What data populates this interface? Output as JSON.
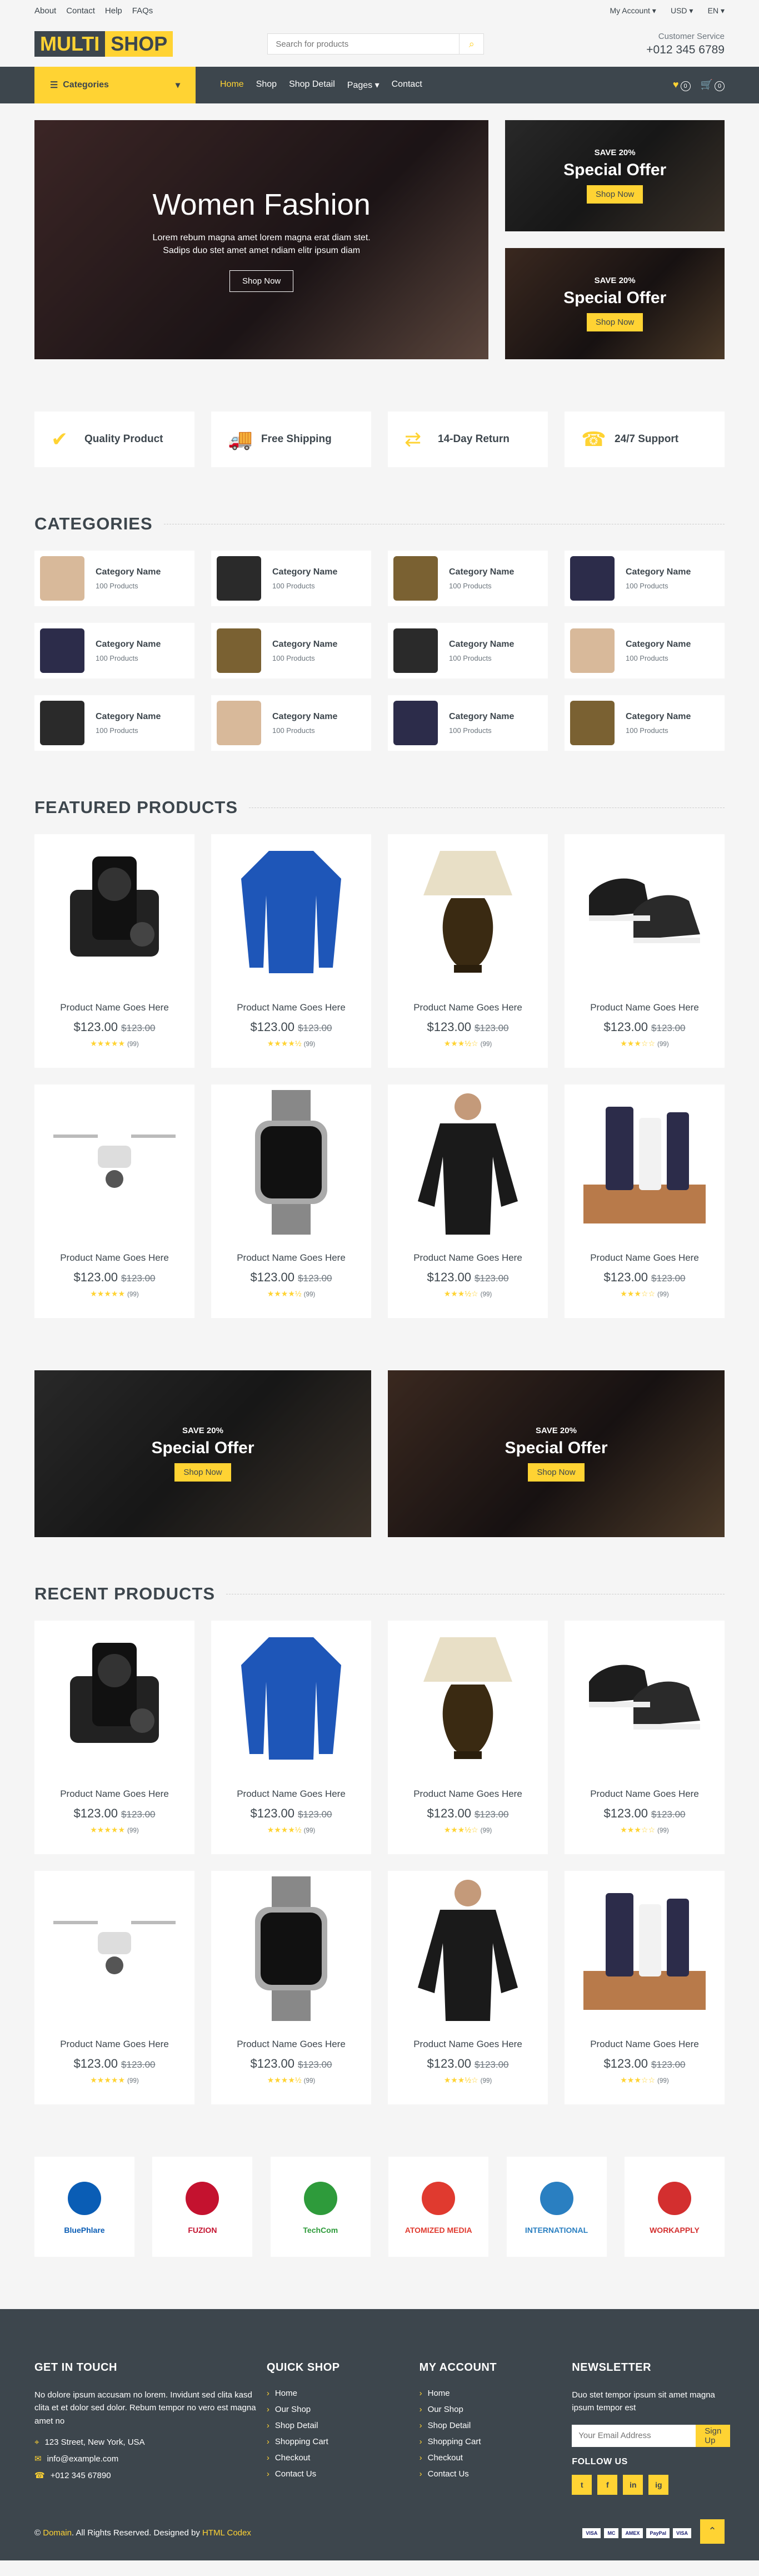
{
  "topbar": {
    "links": [
      "About",
      "Contact",
      "Help",
      "FAQs"
    ],
    "account": "My Account ▾",
    "currency": "USD ▾",
    "lang": "EN ▾"
  },
  "header": {
    "logo_a": "MULTI",
    "logo_b": "SHOP",
    "search_placeholder": "Search for products",
    "cs_label": "Customer Service",
    "cs_phone": "+012 345 6789"
  },
  "nav": {
    "categories": "Categories",
    "menu": [
      "Home",
      "Shop",
      "Shop Detail",
      "Pages ▾",
      "Contact"
    ],
    "wish_count": "0",
    "cart_count": "0"
  },
  "hero": {
    "title": "Women Fashion",
    "text": "Lorem rebum magna amet lorem magna erat diam stet. Sadips duo stet amet amet ndiam elitr ipsum diam",
    "button": "Shop Now"
  },
  "offers": [
    {
      "save": "SAVE 20%",
      "title": "Special Offer",
      "button": "Shop Now"
    },
    {
      "save": "SAVE 20%",
      "title": "Special Offer",
      "button": "Shop Now"
    }
  ],
  "features": [
    {
      "icon": "check-icon",
      "glyph": "✔",
      "label": "Quality Product"
    },
    {
      "icon": "truck-icon",
      "glyph": "🚚",
      "label": "Free Shipping"
    },
    {
      "icon": "exchange-icon",
      "glyph": "⇄",
      "label": "14-Day Return"
    },
    {
      "icon": "phone-icon",
      "glyph": "☎",
      "label": "24/7 Support"
    }
  ],
  "categories_title": "CATEGORIES",
  "categories": [
    {
      "name": "Category Name",
      "count": "100 Products",
      "color": "#d8b99a"
    },
    {
      "name": "Category Name",
      "count": "100 Products",
      "color": "#2a2a2a"
    },
    {
      "name": "Category Name",
      "count": "100 Products",
      "color": "#7a6132"
    },
    {
      "name": "Category Name",
      "count": "100 Products",
      "color": "#2c2c4a"
    },
    {
      "name": "Category Name",
      "count": "100 Products",
      "color": "#2c2c4a"
    },
    {
      "name": "Category Name",
      "count": "100 Products",
      "color": "#7a6132"
    },
    {
      "name": "Category Name",
      "count": "100 Products",
      "color": "#2a2a2a"
    },
    {
      "name": "Category Name",
      "count": "100 Products",
      "color": "#d8b99a"
    },
    {
      "name": "Category Name",
      "count": "100 Products",
      "color": "#2a2a2a"
    },
    {
      "name": "Category Name",
      "count": "100 Products",
      "color": "#d8b99a"
    },
    {
      "name": "Category Name",
      "count": "100 Products",
      "color": "#2c2c4a"
    },
    {
      "name": "Category Name",
      "count": "100 Products",
      "color": "#7a6132"
    }
  ],
  "featured_title": "FEATURED PRODUCTS",
  "recent_title": "RECENT PRODUCTS",
  "products": [
    {
      "name": "Product Name Goes Here",
      "price": "$123.00",
      "old": "$123.00",
      "stars": "★★★★★",
      "reviews": "(99)",
      "img": "camera",
      "color": "#222"
    },
    {
      "name": "Product Name Goes Here",
      "price": "$123.00",
      "old": "$123.00",
      "stars": "★★★★½",
      "reviews": "(99)",
      "img": "sweater",
      "color": "#1e56b8"
    },
    {
      "name": "Product Name Goes Here",
      "price": "$123.00",
      "old": "$123.00",
      "stars": "★★★½☆",
      "reviews": "(99)",
      "img": "lamp",
      "color": "#3a2a12"
    },
    {
      "name": "Product Name Goes Here",
      "price": "$123.00",
      "old": "$123.00",
      "stars": "★★★☆☆",
      "reviews": "(99)",
      "img": "shoes",
      "color": "#1d1d1d"
    },
    {
      "name": "Product Name Goes Here",
      "price": "$123.00",
      "old": "$123.00",
      "stars": "★★★★★",
      "reviews": "(99)",
      "img": "drone",
      "color": "#ddd"
    },
    {
      "name": "Product Name Goes Here",
      "price": "$123.00",
      "old": "$123.00",
      "stars": "★★★★½",
      "reviews": "(99)",
      "img": "watch",
      "color": "#111"
    },
    {
      "name": "Product Name Goes Here",
      "price": "$123.00",
      "old": "$123.00",
      "stars": "★★★½☆",
      "reviews": "(99)",
      "img": "blouse",
      "color": "#1a1a1a"
    },
    {
      "name": "Product Name Goes Here",
      "price": "$123.00",
      "old": "$123.00",
      "stars": "★★★☆☆",
      "reviews": "(99)",
      "img": "cosmetics",
      "color": "#2c2c4a"
    }
  ],
  "offers2": [
    {
      "save": "SAVE 20%",
      "title": "Special Offer",
      "button": "Shop Now"
    },
    {
      "save": "SAVE 20%",
      "title": "Special Offer",
      "button": "Shop Now"
    }
  ],
  "vendors": [
    {
      "name": "BluePhlare",
      "color": "#0a5db5"
    },
    {
      "name": "FUZION",
      "color": "#c4122f"
    },
    {
      "name": "TechCom",
      "color": "#2e9b3b"
    },
    {
      "name": "ATOMIZED MEDIA",
      "color": "#e03a2f"
    },
    {
      "name": "INTERNATIONAL",
      "color": "#2a7fc1"
    },
    {
      "name": "WORKAPPLY",
      "color": "#d32f2f"
    }
  ],
  "footer": {
    "get_title": "GET IN TOUCH",
    "get_text": "No dolore ipsum accusam no lorem. Invidunt sed clita kasd clita et et dolor sed dolor. Rebum tempor no vero est magna amet no",
    "address": "123 Street, New York, USA",
    "email": "info@example.com",
    "phone": "+012 345 67890",
    "quick_title": "QUICK SHOP",
    "quick": [
      "Home",
      "Our Shop",
      "Shop Detail",
      "Shopping Cart",
      "Checkout",
      "Contact Us"
    ],
    "account_title": "MY ACCOUNT",
    "account": [
      "Home",
      "Our Shop",
      "Shop Detail",
      "Shopping Cart",
      "Checkout",
      "Contact Us"
    ],
    "news_title": "NEWSLETTER",
    "news_text": "Duo stet tempor ipsum sit amet magna ipsum tempor est",
    "news_placeholder": "Your Email Address",
    "news_button": "Sign Up",
    "follow": "FOLLOW US",
    "social": [
      "t",
      "f",
      "in",
      "ig"
    ],
    "copy_prefix": "© ",
    "copy_domain": "Domain",
    "copy_mid": ". All Rights Reserved. Designed by ",
    "copy_by": "HTML Codex",
    "pay": [
      "VISA",
      "MC",
      "AMEX",
      "PayPal",
      "VISA"
    ]
  },
  "colors": {
    "accent": "#ffd333",
    "dark": "#3d464d"
  }
}
